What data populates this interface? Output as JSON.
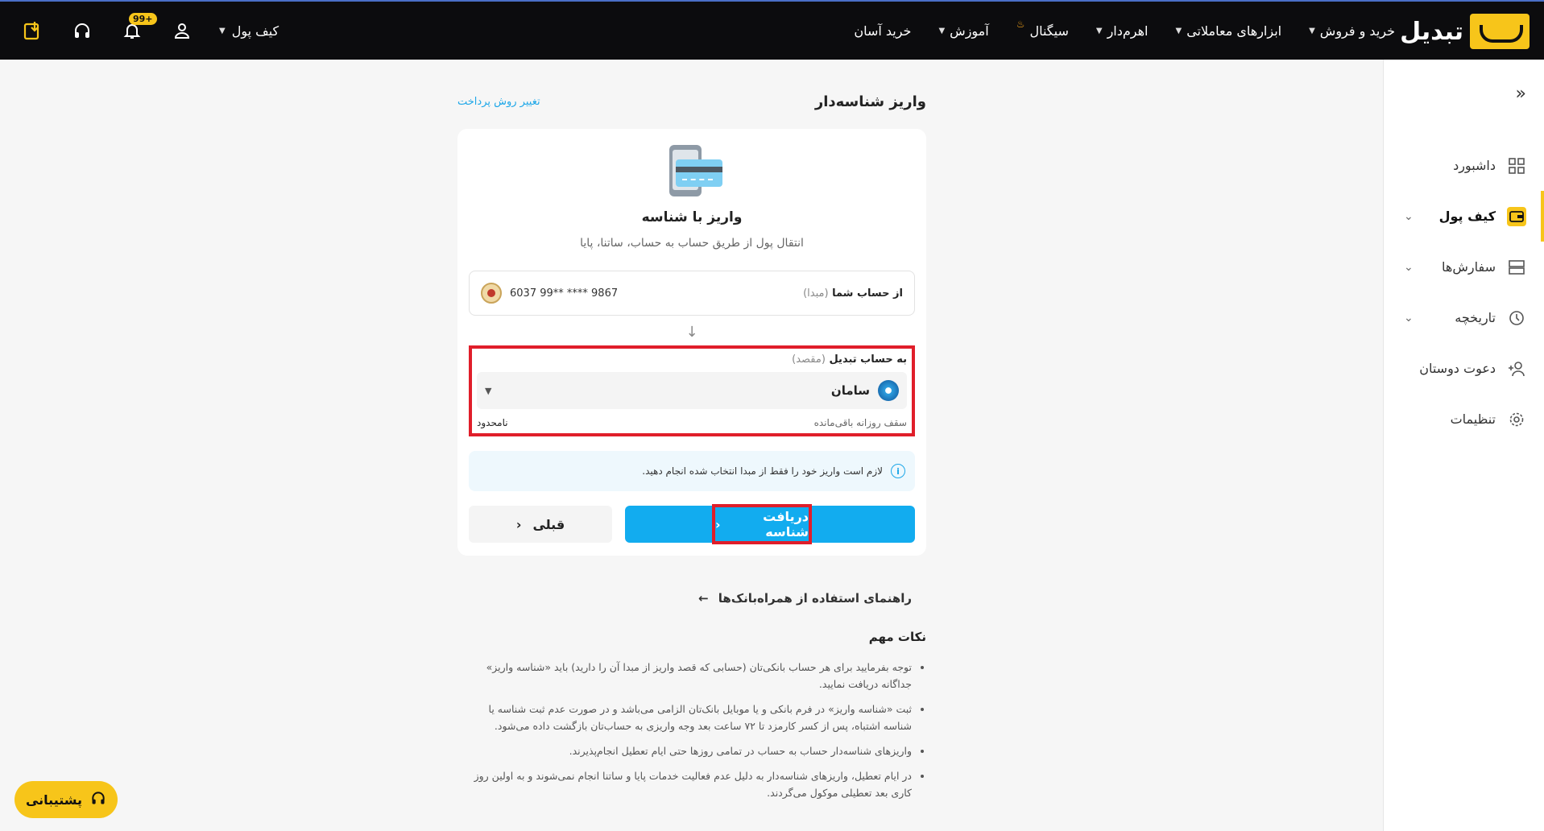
{
  "brand": {
    "name": "تبدیل"
  },
  "topnav": {
    "items": [
      {
        "label": "خرید و فروش",
        "caret": true
      },
      {
        "label": "ابزارهای معاملاتی",
        "caret": true
      },
      {
        "label": "اهرم‌دار",
        "caret": true
      },
      {
        "label": "سیگنال",
        "flame": true
      },
      {
        "label": "آموزش",
        "caret": true
      },
      {
        "label": "خرید آسان",
        "caret": false
      }
    ],
    "wallet_label": "کیف پول",
    "notification_badge": "99+",
    "icons": [
      "download-icon",
      "headset-icon",
      "bell-icon",
      "user-icon"
    ]
  },
  "sidebar": {
    "items": [
      {
        "label": "داشبورد",
        "icon": "dashboard-icon"
      },
      {
        "label": "کیف پول",
        "icon": "wallet-icon",
        "active": true
      },
      {
        "label": "سفارش‌ها",
        "icon": "orders-icon"
      },
      {
        "label": "تاریخچه",
        "icon": "history-icon"
      },
      {
        "label": "دعوت دوستان",
        "icon": "invite-icon"
      },
      {
        "label": "تنظیمات",
        "icon": "settings-icon"
      }
    ]
  },
  "page": {
    "title": "واریز شناسه‌دار",
    "change_method": "تغییر روش پرداخت"
  },
  "card": {
    "title": "واریز با شناسه",
    "subtitle": "انتقال پول از طریق حساب به حساب، ساتنا، پایا",
    "from_label": "از حساب شما",
    "from_hint": "(مبدا)",
    "from_account": "6037 99** **** 9867",
    "to_label": "به حساب تبدیل",
    "to_hint": "(مقصد)",
    "to_bank": "سامان",
    "limit_label": "سقف روزانه باقی‌مانده",
    "limit_value": "نامحدود",
    "notice": "لازم است واریز خود را فقط از مبدا انتخاب شده انجام دهید.",
    "prev_button": "قبلی",
    "next_button": "دریافت شناسه"
  },
  "guide_link": "راهنمای استفاده از همراه‌بانک‌ها",
  "notes": {
    "title": "نکات مهم",
    "items": [
      "توجه بفرمایید برای هر حساب بانکی‌تان (حسابی که قصد واریز از مبدا آن را دارید) باید «شناسه واریز» جداگانه دریافت نمایید.",
      "ثبت «شناسه واریز» در فرم بانکی و یا موبایل بانک‌تان الزامی می‌باشد و در صورت عدم ثبت شناسه یا شناسه اشتباه، پس از کسر کارمزد تا ۷۲ ساعت بعد وجه واریزی به حساب‌تان بازگشت داده می‌شود.",
      "واریزهای شناسه‌دار حساب به حساب در تمامی روزها حتی ایام تعطیل انجام‌پذیرند.",
      "در ایام تعطیل، واریزهای شناسه‌دار به دلیل عدم فعالیت خدمات پایا و ساتنا انجام نمی‌شوند و به اولین روز کاری بعد تعطیلی موکول می‌گردند."
    ]
  },
  "support_label": "پشتیبانی",
  "colors": {
    "accent": "#f7c51a",
    "primary": "#12acef",
    "highlight": "#e01e2a"
  }
}
